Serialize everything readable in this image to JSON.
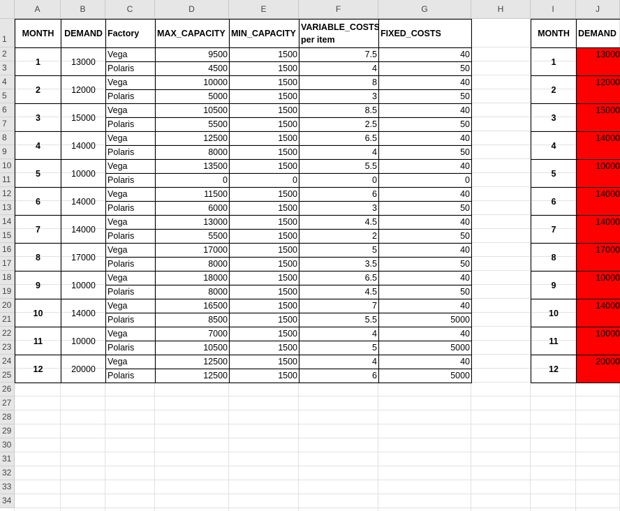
{
  "columns": [
    "A",
    "B",
    "C",
    "D",
    "E",
    "F",
    "G",
    "H",
    "I",
    "J"
  ],
  "rows": [
    "1",
    "2",
    "3",
    "4",
    "5",
    "6",
    "7",
    "8",
    "9",
    "10",
    "11",
    "12",
    "13",
    "14",
    "15",
    "16",
    "17",
    "18",
    "19",
    "20",
    "21",
    "22",
    "23",
    "24",
    "25",
    "26",
    "27",
    "28",
    "29",
    "30",
    "31",
    "32",
    "33",
    "34"
  ],
  "headers": {
    "month": "MONTH",
    "demand": "DEMAND",
    "factory": "Factory",
    "max_capacity": "MAX_CAPACITY",
    "min_capacity": "MIN_CAPACITY",
    "variable_costs_line1": "VARIABLE_COSTS",
    "variable_costs_line2": "per item",
    "fixed_costs": "FIXED_COSTS"
  },
  "table": [
    {
      "month": "1",
      "demand": "13000",
      "vega": {
        "max": "9500",
        "min": "1500",
        "var": "7.5",
        "fixed": "40"
      },
      "polaris": {
        "max": "4500",
        "min": "1500",
        "var": "4",
        "fixed": "50"
      }
    },
    {
      "month": "2",
      "demand": "12000",
      "vega": {
        "max": "10000",
        "min": "1500",
        "var": "8",
        "fixed": "40"
      },
      "polaris": {
        "max": "5000",
        "min": "1500",
        "var": "3",
        "fixed": "50"
      }
    },
    {
      "month": "3",
      "demand": "15000",
      "vega": {
        "max": "10500",
        "min": "1500",
        "var": "8.5",
        "fixed": "40"
      },
      "polaris": {
        "max": "5500",
        "min": "1500",
        "var": "2.5",
        "fixed": "50"
      }
    },
    {
      "month": "4",
      "demand": "14000",
      "vega": {
        "max": "12500",
        "min": "1500",
        "var": "6.5",
        "fixed": "40"
      },
      "polaris": {
        "max": "8000",
        "min": "1500",
        "var": "4",
        "fixed": "50"
      }
    },
    {
      "month": "5",
      "demand": "10000",
      "vega": {
        "max": "13500",
        "min": "1500",
        "var": "5.5",
        "fixed": "40"
      },
      "polaris": {
        "max": "0",
        "min": "0",
        "var": "0",
        "fixed": "0"
      }
    },
    {
      "month": "6",
      "demand": "14000",
      "vega": {
        "max": "11500",
        "min": "1500",
        "var": "6",
        "fixed": "40"
      },
      "polaris": {
        "max": "6000",
        "min": "1500",
        "var": "3",
        "fixed": "50"
      }
    },
    {
      "month": "7",
      "demand": "14000",
      "vega": {
        "max": "13000",
        "min": "1500",
        "var": "4.5",
        "fixed": "40"
      },
      "polaris": {
        "max": "5500",
        "min": "1500",
        "var": "2",
        "fixed": "50"
      }
    },
    {
      "month": "8",
      "demand": "17000",
      "vega": {
        "max": "17000",
        "min": "1500",
        "var": "5",
        "fixed": "40"
      },
      "polaris": {
        "max": "8000",
        "min": "1500",
        "var": "3.5",
        "fixed": "50"
      }
    },
    {
      "month": "9",
      "demand": "10000",
      "vega": {
        "max": "18000",
        "min": "1500",
        "var": "6.5",
        "fixed": "40"
      },
      "polaris": {
        "max": "8000",
        "min": "1500",
        "var": "4.5",
        "fixed": "50"
      }
    },
    {
      "month": "10",
      "demand": "14000",
      "vega": {
        "max": "16500",
        "min": "1500",
        "var": "7",
        "fixed": "40"
      },
      "polaris": {
        "max": "8500",
        "min": "1500",
        "var": "5.5",
        "fixed": "5000"
      }
    },
    {
      "month": "11",
      "demand": "10000",
      "vega": {
        "max": "7000",
        "min": "1500",
        "var": "4",
        "fixed": "40"
      },
      "polaris": {
        "max": "10500",
        "min": "1500",
        "var": "5",
        "fixed": "5000"
      }
    },
    {
      "month": "12",
      "demand": "20000",
      "vega": {
        "max": "12500",
        "min": "1500",
        "var": "4",
        "fixed": "40"
      },
      "polaris": {
        "max": "12500",
        "min": "1500",
        "var": "6",
        "fixed": "5000"
      }
    }
  ],
  "factories": {
    "vega": "Vega",
    "polaris": "Polaris"
  },
  "right_table": [
    {
      "month": "1",
      "demand": "13000"
    },
    {
      "month": "2",
      "demand": "12000"
    },
    {
      "month": "3",
      "demand": "15000"
    },
    {
      "month": "4",
      "demand": "14000"
    },
    {
      "month": "5",
      "demand": "10000"
    },
    {
      "month": "6",
      "demand": "14000"
    },
    {
      "month": "7",
      "demand": "14000"
    },
    {
      "month": "8",
      "demand": "17000"
    },
    {
      "month": "9",
      "demand": "10000"
    },
    {
      "month": "10",
      "demand": "14000"
    },
    {
      "month": "11",
      "demand": "10000"
    },
    {
      "month": "12",
      "demand": "20000"
    }
  ],
  "colors": {
    "demand_highlight": "#ff0000",
    "header_bg": "#e6e6e6",
    "gridline": "#e1e1e1"
  }
}
